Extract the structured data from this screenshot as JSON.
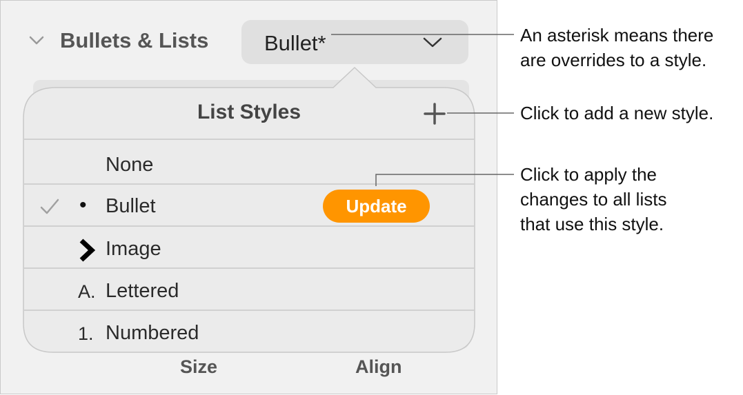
{
  "inspector": {
    "section_title": "Bullets & Lists",
    "style_popup_value": "Bullet*",
    "footer_labels": {
      "size": "Size",
      "align": "Align"
    }
  },
  "list_styles_popover": {
    "title": "List Styles",
    "add_icon": "plus-icon",
    "rows": [
      {
        "label": "None",
        "marker": "",
        "checked": false
      },
      {
        "label": "Bullet",
        "marker": "•",
        "checked": true,
        "check_icon": "checkmark-icon"
      },
      {
        "label": "Image",
        "marker": "chevron-right-icon",
        "checked": false
      },
      {
        "label": "Lettered",
        "marker": "A.",
        "checked": false
      },
      {
        "label": "Numbered",
        "marker": "1.",
        "checked": false
      }
    ],
    "update_button_label": "Update"
  },
  "callouts": {
    "asterisk": [
      "An asterisk means there",
      "are overrides to a style."
    ],
    "add_style": [
      "Click to add a new style."
    ],
    "update": [
      "Click to apply the",
      "changes to all lists",
      "that use this style."
    ]
  },
  "colors": {
    "update_button": "#ff9500",
    "panel_background": "#f1f1f1",
    "popover_background": "#ebebeb"
  }
}
